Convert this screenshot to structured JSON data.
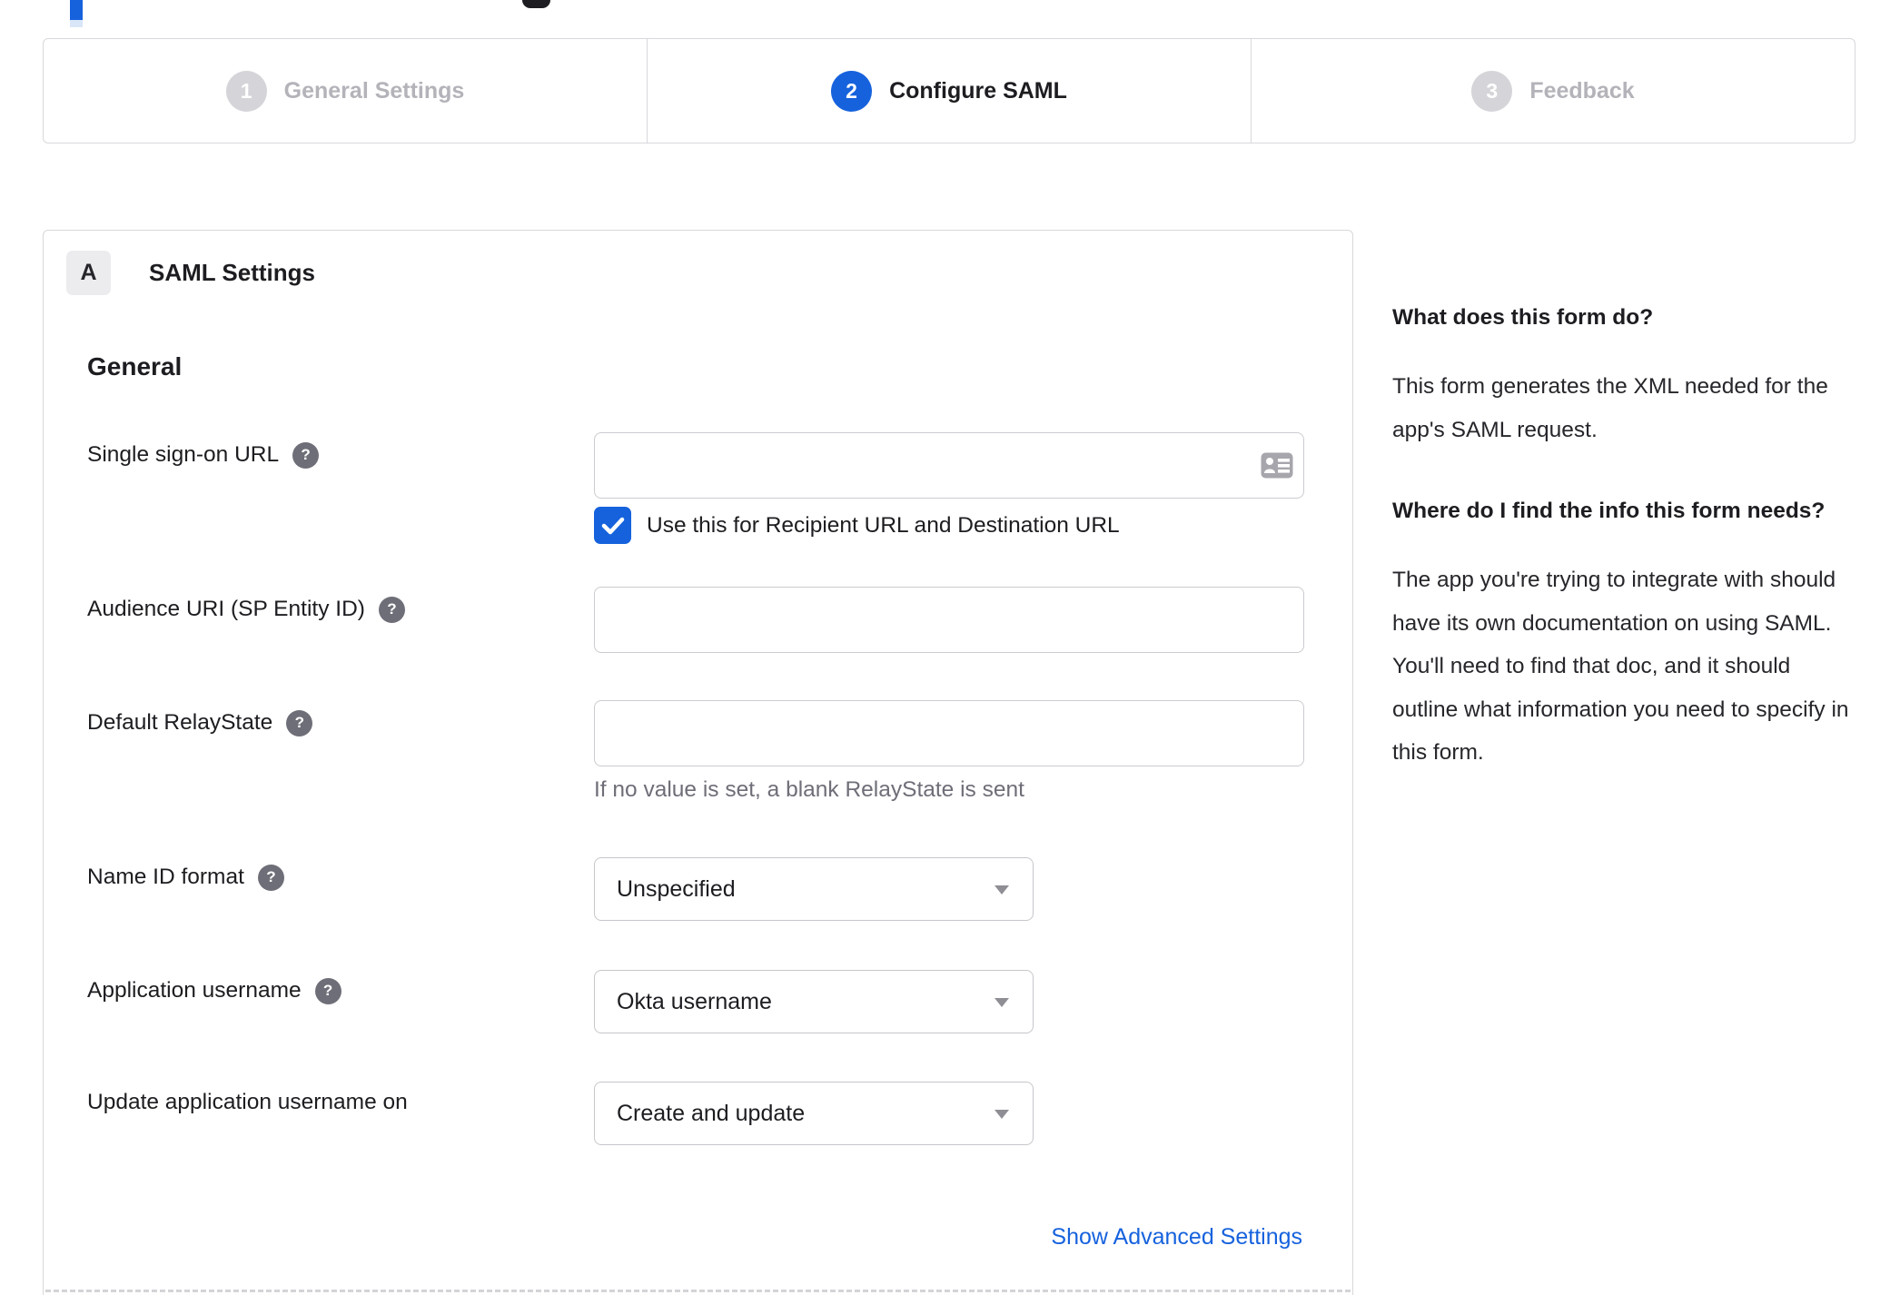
{
  "colors": {
    "accent_blue": "#1662dd",
    "inactive_gray": "#b3b3b9",
    "border_gray": "#d8d8dc",
    "text_dark": "#1d1d21",
    "muted_text": "#6e6e78"
  },
  "stepper": {
    "steps": [
      {
        "number": "1",
        "label": "General Settings",
        "state": "inactive"
      },
      {
        "number": "2",
        "label": "Configure SAML",
        "state": "active"
      },
      {
        "number": "3",
        "label": "Feedback",
        "state": "inactive"
      }
    ]
  },
  "panel": {
    "section_badge": "A",
    "section_title": "SAML Settings",
    "group_title": "General",
    "help_glyph": "?",
    "fields": {
      "sso": {
        "label": "Single sign-on URL",
        "value": "",
        "checkbox": {
          "checked": true,
          "label": "Use this for Recipient URL and Destination URL"
        }
      },
      "audience": {
        "label": "Audience URI (SP Entity ID)",
        "value": ""
      },
      "relay": {
        "label": "Default RelayState",
        "value": "",
        "helper": "If no value is set, a blank RelayState is sent"
      },
      "name_id": {
        "label": "Name ID format",
        "value": "Unspecified"
      },
      "app_username": {
        "label": "Application username",
        "value": "Okta username"
      },
      "update_username": {
        "label": "Update application username on",
        "value": "Create and update"
      }
    },
    "advanced_link": "Show Advanced Settings"
  },
  "sidebar": {
    "blocks": [
      {
        "heading": "What does this form do?",
        "body": "This form generates the XML needed for the app's SAML request."
      },
      {
        "heading": "Where do I find the info this form needs?",
        "body": "The app you're trying to integrate with should have its own documentation on using SAML. You'll need to find that doc, and it should outline what information you need to specify in this form."
      }
    ]
  }
}
